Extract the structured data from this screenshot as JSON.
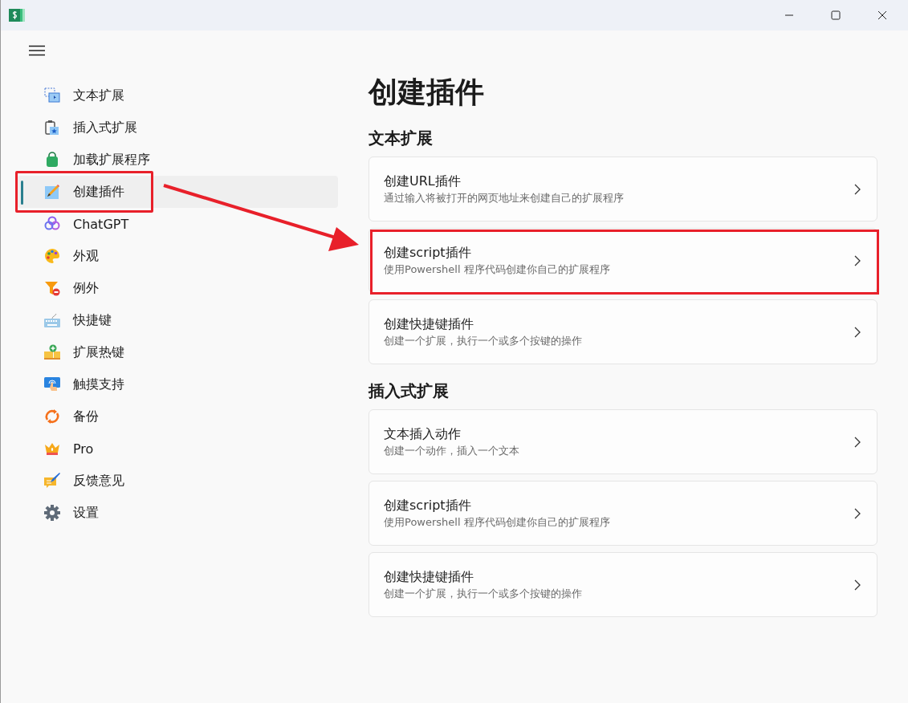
{
  "sidebar": {
    "items": [
      {
        "label": "文本扩展",
        "selected": false,
        "highlighted": false
      },
      {
        "label": "插入式扩展",
        "selected": false,
        "highlighted": false
      },
      {
        "label": "加载扩展程序",
        "selected": false,
        "highlighted": false
      },
      {
        "label": "创建插件",
        "selected": true,
        "highlighted": true
      },
      {
        "label": "ChatGPT",
        "selected": false,
        "highlighted": false
      },
      {
        "label": "外观",
        "selected": false,
        "highlighted": false
      },
      {
        "label": "例外",
        "selected": false,
        "highlighted": false
      },
      {
        "label": "快捷键",
        "selected": false,
        "highlighted": false
      },
      {
        "label": "扩展热键",
        "selected": false,
        "highlighted": false
      },
      {
        "label": "触摸支持",
        "selected": false,
        "highlighted": false
      },
      {
        "label": "备份",
        "selected": false,
        "highlighted": false
      },
      {
        "label": "Pro",
        "selected": false,
        "highlighted": false
      },
      {
        "label": "反馈意见",
        "selected": false,
        "highlighted": false
      },
      {
        "label": "设置",
        "selected": false,
        "highlighted": false
      }
    ]
  },
  "page": {
    "title": "创建插件",
    "sections": [
      {
        "heading": "文本扩展",
        "cards": [
          {
            "title": "创建URL插件",
            "description": "通过输入将被打开的网页地址来创建自己的扩展程序",
            "highlighted": false
          },
          {
            "title": "创建script插件",
            "description": "使用Powershell 程序代码创建你自己的扩展程序",
            "highlighted": true
          },
          {
            "title": "创建快捷键插件",
            "description": "创建一个扩展，执行一个或多个按键的操作",
            "highlighted": false
          }
        ]
      },
      {
        "heading": "插入式扩展",
        "cards": [
          {
            "title": "文本插入动作",
            "description": "创建一个动作，插入一个文本",
            "highlighted": false
          },
          {
            "title": "创建script插件",
            "description": "使用Powershell 程序代码创建你自己的扩展程序",
            "highlighted": false
          },
          {
            "title": "创建快捷键插件",
            "description": "创建一个扩展，执行一个或多个按键的操作",
            "highlighted": false
          }
        ]
      }
    ]
  },
  "annotation": {
    "arrow": true
  }
}
